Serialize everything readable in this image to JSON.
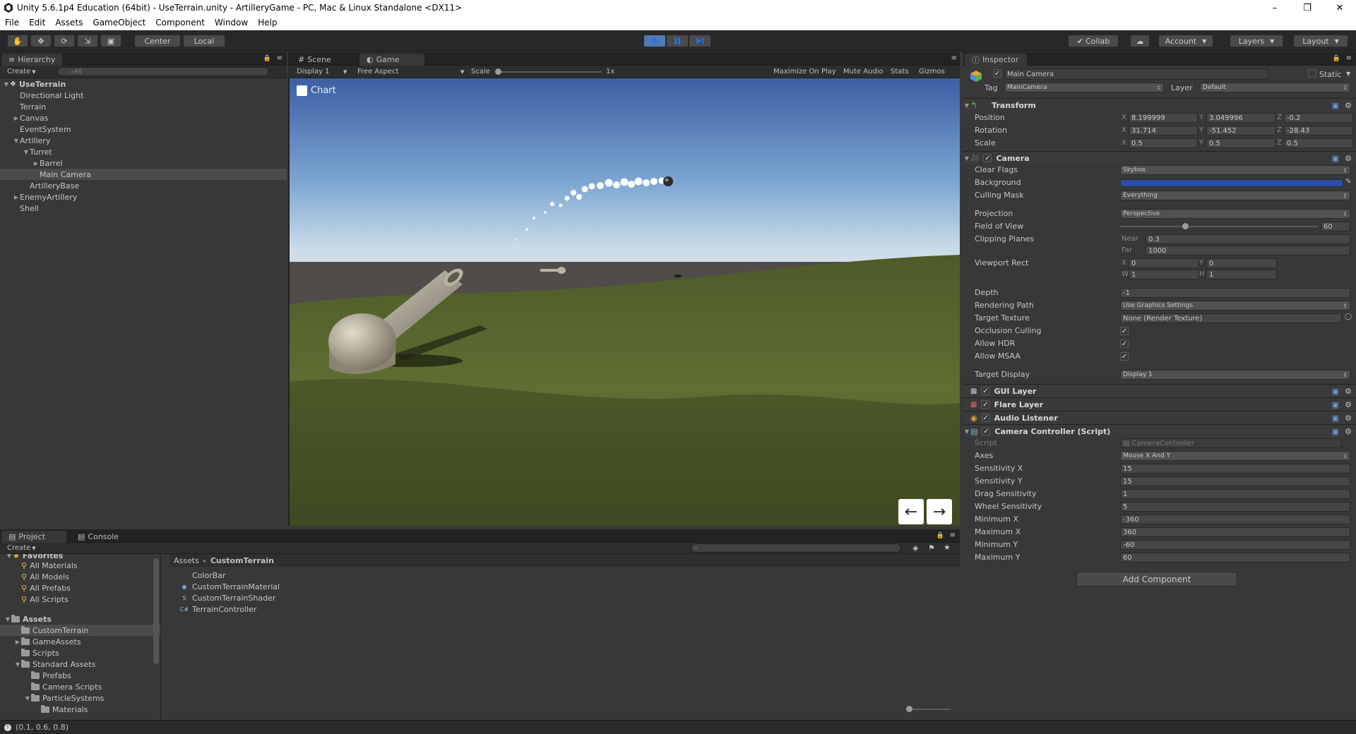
{
  "window": {
    "title": "Unity 5.6.1p4 Education (64bit) - UseTerrain.unity - ArtilleryGame - PC, Mac & Linux Standalone <DX11>",
    "controls": {
      "minimize": "–",
      "restore": "❐",
      "close": "✕"
    }
  },
  "menu": [
    "File",
    "Edit",
    "Assets",
    "GameObject",
    "Component",
    "Window",
    "Help"
  ],
  "toolbar": {
    "pivot_center": "Center",
    "pivot_local": "Local",
    "collab": "Collab",
    "account": "Account",
    "layers": "Layers",
    "layout": "Layout"
  },
  "hierarchy": {
    "tab": "Hierarchy",
    "create": "Create",
    "search_placeholder": "⌕All",
    "items": [
      {
        "label": "UseTerrain",
        "depth": 0,
        "arrow": "▼",
        "bold": true
      },
      {
        "label": "Directional Light",
        "depth": 1,
        "arrow": ""
      },
      {
        "label": "Terrain",
        "depth": 1,
        "arrow": ""
      },
      {
        "label": "Canvas",
        "depth": 1,
        "arrow": "▶"
      },
      {
        "label": "EventSystem",
        "depth": 1,
        "arrow": ""
      },
      {
        "label": "Artillery",
        "depth": 1,
        "arrow": "▼"
      },
      {
        "label": "Turret",
        "depth": 2,
        "arrow": "▼"
      },
      {
        "label": "Barrel",
        "depth": 3,
        "arrow": "▶"
      },
      {
        "label": "Main Camera",
        "depth": 3,
        "arrow": "",
        "selected": true
      },
      {
        "label": "ArtilleryBase",
        "depth": 2,
        "arrow": ""
      },
      {
        "label": "EnemyArtillery",
        "depth": 1,
        "arrow": "▶"
      },
      {
        "label": "Shell",
        "depth": 1,
        "arrow": ""
      }
    ]
  },
  "game_view": {
    "tab_scene": "Scene",
    "tab_game": "Game",
    "display": "Display 1",
    "aspect": "Free Aspect",
    "scale_label": "Scale",
    "scale_value": "1x",
    "maximize": "Maximize On Play",
    "mute": "Mute Audio",
    "stats": "Stats",
    "gizmos": "Gizmos",
    "chart_toggle": "Chart",
    "arrow_left": "←",
    "arrow_right": "→"
  },
  "inspector": {
    "tab": "Inspector",
    "object_name": "Main Camera",
    "static_label": "Static",
    "tag_label": "Tag",
    "tag_value": "MainCamera",
    "layer_label": "Layer",
    "layer_value": "Default",
    "transform": {
      "title": "Transform",
      "rows": [
        {
          "label": "Position",
          "x": "8.199999",
          "y": "3.049996",
          "z": "-0.2"
        },
        {
          "label": "Rotation",
          "x": "31.714",
          "y": "-51.452",
          "z": "-28.43"
        },
        {
          "label": "Scale",
          "x": "0.5",
          "y": "0.5",
          "z": "0.5"
        }
      ]
    },
    "camera": {
      "title": "Camera",
      "clear_flags": {
        "label": "Clear Flags",
        "value": "Skybox"
      },
      "background": {
        "label": "Background",
        "color": "#2a4ea8"
      },
      "culling_mask": {
        "label": "Culling Mask",
        "value": "Everything"
      },
      "projection": {
        "label": "Projection",
        "value": "Perspective"
      },
      "fov": {
        "label": "Field of View",
        "value": "60",
        "fraction": 0.33
      },
      "clipping": {
        "label": "Clipping Planes",
        "near_label": "Near",
        "near": "0.3",
        "far_label": "Far",
        "far": "1000"
      },
      "viewport": {
        "label": "Viewport Rect",
        "x": "0",
        "y": "0",
        "w": "1",
        "h": "1"
      },
      "depth": {
        "label": "Depth",
        "value": "-1"
      },
      "rendering_path": {
        "label": "Rendering Path",
        "value": "Use Graphics Settings"
      },
      "target_texture": {
        "label": "Target Texture",
        "value": "None (Render Texture)"
      },
      "occlusion": {
        "label": "Occlusion Culling",
        "checked": true
      },
      "hdr": {
        "label": "Allow HDR",
        "checked": true
      },
      "msaa": {
        "label": "Allow MSAA",
        "checked": true
      },
      "target_display": {
        "label": "Target Display",
        "value": "Display 1"
      }
    },
    "gui_layer": "GUI Layer",
    "flare_layer": "Flare Layer",
    "audio_listener": "Audio Listener",
    "controller": {
      "title": "Camera Controller (Script)",
      "script_label": "Script",
      "script_value": "CameraController",
      "rows": [
        {
          "label": "Axes",
          "value": "Mouse X And Y",
          "dropdown": true
        },
        {
          "label": "Sensitivity X",
          "value": "15"
        },
        {
          "label": "Sensitivity Y",
          "value": "15"
        },
        {
          "label": "Drag Sensitivity",
          "value": "1"
        },
        {
          "label": "Wheel Sensitivity",
          "value": "5"
        },
        {
          "label": "Minimum X",
          "value": "-360"
        },
        {
          "label": "Maximum X",
          "value": "360"
        },
        {
          "label": "Minimum Y",
          "value": "-60"
        },
        {
          "label": "Maximum Y",
          "value": "60"
        }
      ]
    },
    "add_component": "Add Component"
  },
  "project": {
    "tab_project": "Project",
    "tab_console": "Console",
    "create": "Create",
    "favorites_label": "Favorites",
    "favorites": [
      "All Materials",
      "All Models",
      "All Prefabs",
      "All Scripts"
    ],
    "assets_label": "Assets",
    "tree": [
      {
        "label": "CustomTerrain",
        "depth": 1,
        "arrow": "",
        "selected": true
      },
      {
        "label": "GameAssets",
        "depth": 1,
        "arrow": "▶"
      },
      {
        "label": "Scripts",
        "depth": 1,
        "arrow": ""
      },
      {
        "label": "Standard Assets",
        "depth": 1,
        "arrow": "▼"
      },
      {
        "label": "Prefabs",
        "depth": 2,
        "arrow": ""
      },
      {
        "label": "Camera Scripts",
        "depth": 2,
        "arrow": ""
      },
      {
        "label": "ParticleSystems",
        "depth": 2,
        "arrow": "▼"
      },
      {
        "label": "Materials",
        "depth": 3,
        "arrow": ""
      }
    ],
    "breadcrumb_root": "Assets",
    "breadcrumb_sep": "▸",
    "breadcrumb_current": "CustomTerrain",
    "files": [
      {
        "label": "ColorBar",
        "icon": "none"
      },
      {
        "label": "CustomTerrainMaterial",
        "icon": "material"
      },
      {
        "label": "CustomTerrainShader",
        "icon": "shader"
      },
      {
        "label": "TerrainController",
        "icon": "script"
      }
    ]
  },
  "status": {
    "text": "(0.1, 0.6, 0.8)"
  }
}
